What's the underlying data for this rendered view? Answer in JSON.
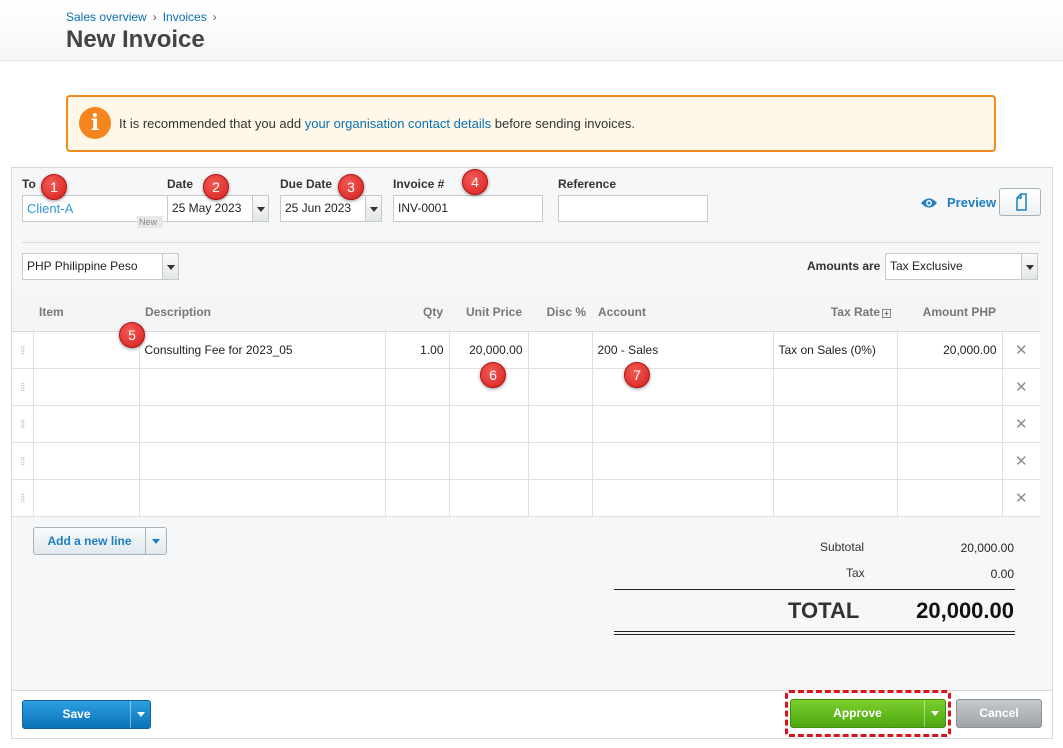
{
  "breadcrumb": {
    "items": [
      "Sales overview",
      "Invoices"
    ],
    "separator": "›"
  },
  "page": {
    "title": "New Invoice"
  },
  "alert": {
    "text_before": "It is recommended that you add ",
    "link": "your organisation contact details",
    "text_after": " before sending invoices.",
    "icon": "info-icon",
    "icon_glyph": "i"
  },
  "form": {
    "to": {
      "label": "To",
      "value": "Client-A",
      "badge": "New"
    },
    "date": {
      "label": "Date",
      "value": "25 May 2023"
    },
    "due_date": {
      "label": "Due Date",
      "value": "25 Jun 2023"
    },
    "invoice_number": {
      "label": "Invoice #",
      "value": "INV-0001"
    },
    "reference": {
      "label": "Reference",
      "value": ""
    },
    "currency": {
      "value": "PHP Philippine Peso"
    },
    "amounts_are": {
      "label": "Amounts are",
      "value": "Tax Exclusive"
    }
  },
  "preview": {
    "label": "Preview",
    "icon": "eye-icon"
  },
  "copy_button": {
    "icon": "copy-icon"
  },
  "table": {
    "columns": [
      "Item",
      "Description",
      "Qty",
      "Unit Price",
      "Disc %",
      "Account",
      "Tax Rate",
      "Amount PHP"
    ],
    "tax_rate_toggle": "+",
    "handle_glyph": "⁞⁞",
    "delete_glyph": "✕",
    "rows": [
      {
        "item": "",
        "description": "Consulting Fee for 2023_05",
        "qty": "1.00",
        "unit_price": "20,000.00",
        "disc": "",
        "account": "200 - Sales",
        "tax_rate": "Tax on Sales (0%)",
        "amount": "20,000.00"
      },
      {
        "item": "",
        "description": "",
        "qty": "",
        "unit_price": "",
        "disc": "",
        "account": "",
        "tax_rate": "",
        "amount": ""
      },
      {
        "item": "",
        "description": "",
        "qty": "",
        "unit_price": "",
        "disc": "",
        "account": "",
        "tax_rate": "",
        "amount": ""
      },
      {
        "item": "",
        "description": "",
        "qty": "",
        "unit_price": "",
        "disc": "",
        "account": "",
        "tax_rate": "",
        "amount": ""
      },
      {
        "item": "",
        "description": "",
        "qty": "",
        "unit_price": "",
        "disc": "",
        "account": "",
        "tax_rate": "",
        "amount": ""
      }
    ]
  },
  "add_line": {
    "label": "Add a new line"
  },
  "totals": {
    "subtotal_label": "Subtotal",
    "subtotal": "20,000.00",
    "tax_label": "Tax",
    "tax": "0.00",
    "total_label": "TOTAL",
    "total": "20,000.00"
  },
  "actions": {
    "save": "Save",
    "approve": "Approve",
    "cancel": "Cancel"
  },
  "annotations": [
    "1",
    "2",
    "3",
    "4",
    "5",
    "6",
    "7"
  ],
  "colors": {
    "accent": "#0a71b3",
    "approve": "#5cb81b",
    "save": "#1a86cc",
    "highlight": "#d9151c",
    "alert_border": "#f08c1e",
    "marker": "#e02a2a"
  }
}
